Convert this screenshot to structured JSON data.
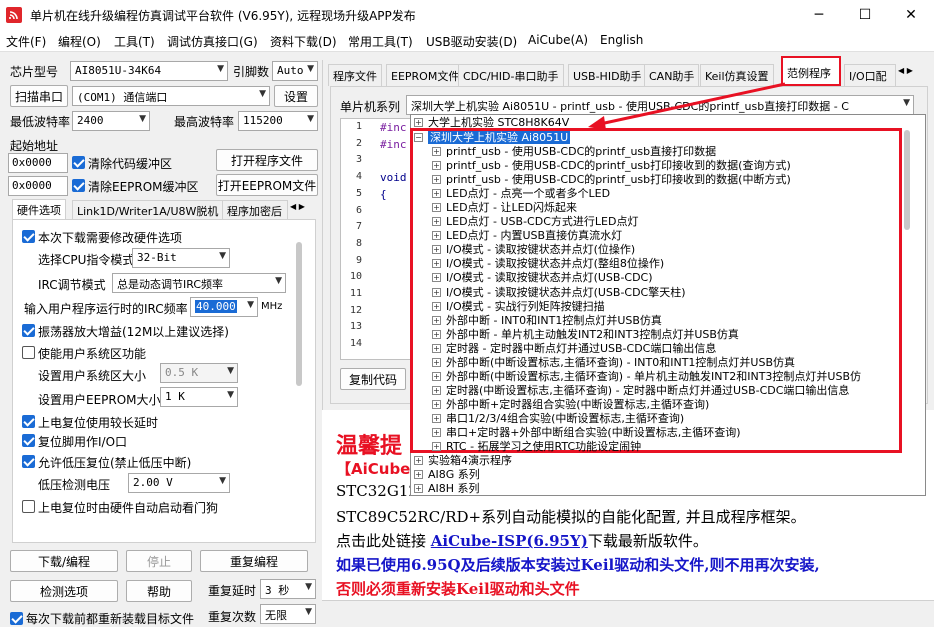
{
  "window": {
    "title": "单片机在线升级编程仿真调试平台软件 (V6.95Y), 远程现场升级APP发布",
    "minimize": "─",
    "maximize": "☐",
    "close": "✕"
  },
  "menu": [
    "文件(F)",
    "编程(O)",
    "工具(T)",
    "调试仿真接口(G)",
    "资料下载(D)",
    "常用工具(T)",
    "USB驱动安装(D)",
    "AiCube(A)",
    "English"
  ],
  "left": {
    "chip_label": "芯片型号",
    "chip_value": "AI8051U-34K64",
    "pin_label": "引脚数",
    "pin_value": "Auto",
    "scan_button": "扫描串口",
    "port_value": "(COM1) 通信端口",
    "settings_button": "设置",
    "min_baud_label": "最低波特率",
    "min_baud_value": "2400",
    "max_baud_label": "最高波特率",
    "max_baud_value": "115200",
    "start_addr_label": "起始地址",
    "addr1": "0x0000",
    "clear_code_label": "清除代码缓冲区",
    "open_program_button": "打开程序文件",
    "addr2": "0x0000",
    "clear_eeprom_label": "清除EEPROM缓冲区",
    "open_eeprom_button": "打开EEPROM文件",
    "tabs": [
      "硬件选项",
      "Link1D/Writer1A/U8W脱机",
      "程序加密后"
    ],
    "hw": {
      "modify_label": "本次下载需要修改硬件选项",
      "cpu_label": "选择CPU指令模式",
      "cpu_value": "32-Bit",
      "irc_label": "IRC调节模式",
      "irc_value": "总是动态调节IRC频率",
      "freq_label": "输入用户程序运行时的IRC频率",
      "freq_value": "40.000",
      "freq_unit": "MHz",
      "osc_label": "振荡器放大增益(12M以上建议选择)",
      "sys_area_label": "使能用户系统区功能",
      "sys_size_label": "设置用户系统区大小",
      "sys_size_value": "0.5 K",
      "eeprom_size_label": "设置用户EEPROM大小",
      "eeprom_size_value": "1   K",
      "power_delay_label": "上电复位使用较长延时",
      "reset_pin_label": "复位脚用作I/O口",
      "lvr_label": "允许低压复位(禁止低压中断)",
      "lvd_label": "低压检测电压",
      "lvd_value": "2.00 V",
      "watchdog_label": "上电复位时由硬件自动启动看门狗"
    },
    "download_button": "下载/编程",
    "stop_button": "停止",
    "reprogram_button": "重复编程",
    "check_button": "检测选项",
    "help_button": "帮助",
    "repeat_delay_label": "重复延时",
    "repeat_delay_value": "3 秒",
    "reload_label": "每次下载前都重新装载目标文件",
    "repeat_count_label": "重复次数",
    "repeat_count_value": "无限"
  },
  "right": {
    "tabs": [
      "程序文件",
      "EEPROM文件",
      "CDC/HID-串口助手",
      "USB-HID助手",
      "CAN助手",
      "Keil仿真设置",
      "范例程序",
      "I/O口配"
    ],
    "series_label": "单片机系列",
    "series_value": "深圳大学上机实验 Ai8051U - printf_usb - 使用USB-CDC的printf_usb直接打印数据 - C",
    "code_lines": [
      "#inc",
      "#inc",
      "",
      "void",
      "{",
      "",
      "",
      "",
      "",
      "",
      "",
      "",
      "",
      ""
    ],
    "line_numbers": [
      "1",
      "2",
      "3",
      "4",
      "5",
      "6",
      "7",
      "8",
      "9",
      "10",
      "11",
      "12",
      "13",
      "14"
    ],
    "copy_button": "复制代码",
    "tree_top": [
      "大学上机实验 STC8H8K64V",
      "深圳大学上机实验 Ai8051U"
    ],
    "tree_items": [
      "printf_usb - 使用USB-CDC的printf_usb直接打印数据",
      "printf_usb - 使用USB-CDC的printf_usb打印接收到的数据(查询方式)",
      "printf_usb - 使用USB-CDC的printf_usb打印接收到的数据(中断方式)",
      "LED点灯 - 点亮一个或者多个LED",
      "LED点灯 - 让LED闪烁起来",
      "LED点灯 - USB-CDC方式进行LED点灯",
      "LED点灯 - 内置USB直接仿真流水灯",
      "I/O模式 - 读取按键状态并点灯(位操作)",
      "I/O模式 - 读取按键状态并点灯(整组8位操作)",
      "I/O模式 - 读取按键状态并点灯(USB-CDC)",
      "I/O模式 - 读取按键状态并点灯(USB-CDC擎天柱)",
      "I/O模式 - 实战行列矩阵按键扫描",
      "外部中断 - INT0和INT1控制点灯并USB仿真",
      "外部中断 - 单片机主动触发INT2和INT3控制点灯并USB仿真",
      "定时器 - 定时器中断点灯并通过USB-CDC端口输出信息",
      "外部中断(中断设置标志,主循环查询) - INT0和INT1控制点灯并USB仿真",
      "外部中断(中断设置标志,主循环查询) - 单片机主动触发INT2和INT3控制点灯并USB仿",
      "定时器(中断设置标志,主循环查询) - 定时器中断点灯并通过USB-CDC端口输出信息",
      "外部中断+定时器组合实验(中断设置标志,主循环查询)",
      "串口1/2/3/4组合实验(中断设置标志,主循环查询)",
      "串口+定时器+外部中断组合实验(中断设置标志,主循环查询)",
      "RTC - 拓展学习之使用RTC功能设定闹钟"
    ],
    "tree_bottom": [
      "实验箱4演示程序",
      "AI8G 系列",
      "AI8H 系列"
    ],
    "notice_title": "温馨提",
    "notice_line1": "【AiCube",
    "notice_line2": "STC32G12",
    "notice_line3": "STC89C52RC/RD+系列自动能模拟的自能化配置, 并且成程序框架。",
    "notice_link_pre": "点击此处链接",
    "notice_link": "AiCube-ISP(6.95Y)",
    "notice_link_post": "下载最新版软件。",
    "notice_blue": "如果已使用6.95Q及后续版本安装过Keil驱动和头文件,则不用再次安装,",
    "notice_red": "否则必须重新安装Keil驱动和头文件"
  },
  "colors": {
    "highlight_red": "#e81123",
    "accent_blue": "#1a6bd5",
    "notice_red": "#e81123",
    "notice_blue": "#1515c8"
  }
}
